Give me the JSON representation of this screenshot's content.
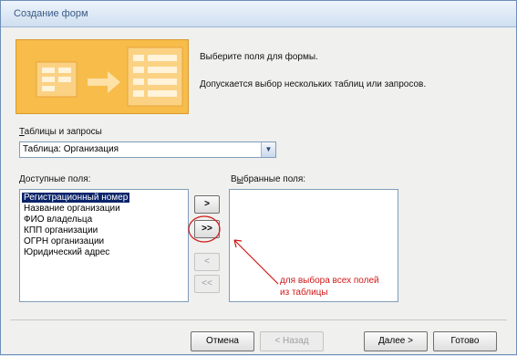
{
  "window": {
    "title": "Создание форм"
  },
  "header": {
    "line1": "Выберите поля для формы.",
    "line2": "Допускается выбор нескольких таблиц или запросов."
  },
  "tables": {
    "label_accel": "Т",
    "label_rest": "аблицы и запросы",
    "selected": "Таблица: Организация"
  },
  "available": {
    "label_accel": "Д",
    "label_rest": "оступные поля:",
    "items": [
      "Регистрационный номер",
      "Название организации",
      "ФИО владельца",
      "КПП организации",
      "ОГРН организации",
      "Юридический адрес"
    ]
  },
  "selected_fields": {
    "label_pre": "В",
    "label_accel": "ы",
    "label_rest": "бранные поля:"
  },
  "move": {
    "one": ">",
    "all": ">>",
    "back_one": "<",
    "back_all": "<<"
  },
  "footer": {
    "cancel": "Отмена",
    "back": "< Назад",
    "next": "Далее >",
    "finish": "Готово"
  },
  "annotation": {
    "line1": "для выбора всех полей",
    "line2": "из таблицы",
    "color": "#d01818"
  }
}
